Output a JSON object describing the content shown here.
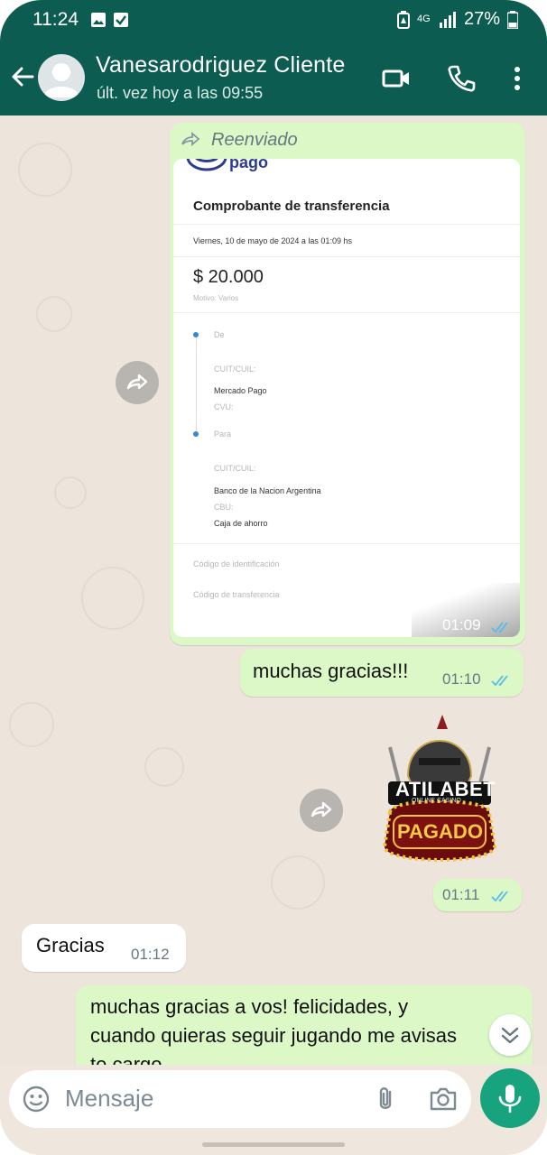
{
  "status_bar": {
    "time": "11:24",
    "network": "4G",
    "battery": "27%"
  },
  "header": {
    "contact_name": "Vanesarodriguez Cliente",
    "last_seen": "últ. vez hoy a las 09:55"
  },
  "messages": [
    {
      "direction": "out",
      "type": "forwarded-image",
      "forwarded_label": "Reenviado",
      "time": "01:09",
      "receipt": {
        "brand": "pago",
        "heading": "Comprobante de transferencia",
        "date": "Viernes, 10 de mayo de 2024 a las 01:09 hs",
        "amount": "$ 20.000",
        "motivo": "Motivo: Varios",
        "from_label": "De",
        "from_cuit_label": "CUIT/CUIL:",
        "from_bank": "Mercado Pago",
        "from_cvu_label": "CVU:",
        "to_label": "Para",
        "to_cuit_label": "CUIT/CUIL:",
        "to_bank": "Banco de la Nacion Argentina",
        "to_cbu_label": "CBU:",
        "to_account": "Caja de ahorro",
        "id_label": "Código de identificación",
        "transfer_label": "Código de transferencia"
      }
    },
    {
      "direction": "out",
      "type": "text",
      "text": "muchas gracias!!!",
      "time": "01:10"
    },
    {
      "direction": "out",
      "type": "sticker",
      "sticker_title": "ATILABET",
      "sticker_subtitle": "ONLINE CASINO",
      "sticker_sign": "PAGADO",
      "time": "01:11"
    },
    {
      "direction": "in",
      "type": "text",
      "text": "Gracias",
      "time": "01:12"
    },
    {
      "direction": "out",
      "type": "text",
      "line1": "muchas gracias a vos! felicidades, y",
      "line2": "cuando quieras seguir jugando me avisas",
      "line3": "te cargo"
    }
  ],
  "composer": {
    "placeholder": "Mensaje"
  },
  "colors": {
    "header": "#0d5c52",
    "outgoing_bubble": "#dcf8c6",
    "mic_button": "#16a37d",
    "read_ticks": "#53bdeb"
  },
  "icons": [
    "back-arrow-icon",
    "video-call-icon",
    "phone-icon",
    "more-options-icon",
    "forward-icon",
    "emoji-icon",
    "attach-icon",
    "camera-icon",
    "mic-icon",
    "double-chevron-down-icon"
  ]
}
